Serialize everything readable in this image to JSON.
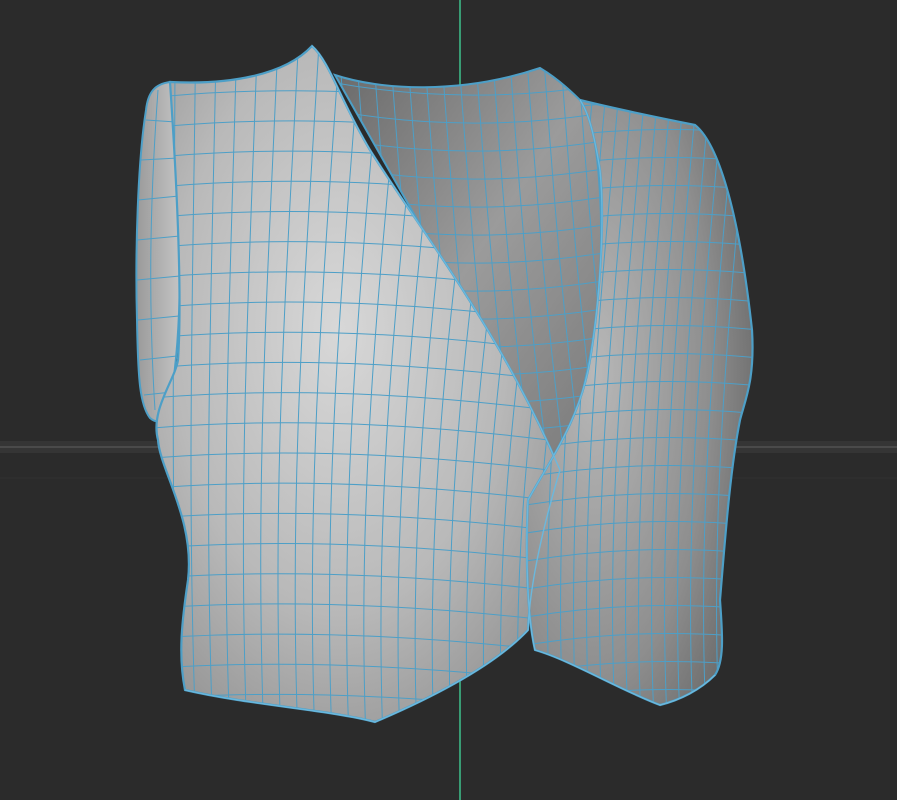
{
  "viewport": {
    "background": "#2b2b2b",
    "grid_color": "#3c3c3c",
    "y_axis_color": "#3ec28c",
    "wire_color": "#4d9fc7",
    "wire_highlight": "#6bb8dd",
    "object_icon": "vest-mesh-icon"
  }
}
